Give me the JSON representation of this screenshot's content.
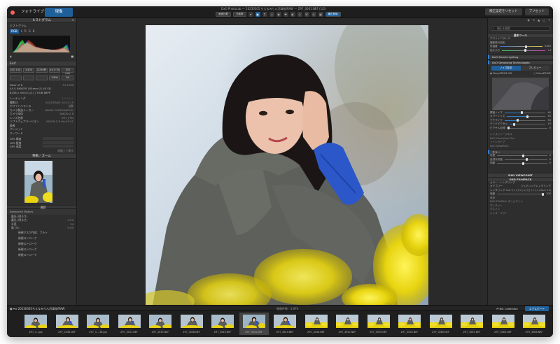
{
  "titlebar": {
    "tab_library": "フォトライブラリ",
    "tab_develop": "現像",
    "document_title": "DxO PhotoLab — 20230305 ちえ＆みりん河津桜/RAW — Z97_0001.NEF (1/2)",
    "toolbar_left_btn": "画面比較",
    "toolbar_mid_btn": "元画像",
    "toolbar_right_btn": "補正前後",
    "reset_button": "補正設定をリセット",
    "preset_button": "プリセット"
  },
  "left_panel": {
    "histogram_title": "ヒストグラム",
    "histogram_subtitle": "ヒストグラム",
    "histogram_colors": {
      "red": "#e23a3a",
      "green": "#3ad94a",
      "blue": "#2f6ef0"
    },
    "exif_title": "Exif",
    "exif_chips": [
      "ISO 100",
      "1/400",
      "1/250秒",
      "±0.0 EV",
      "105 mm"
    ],
    "exif_chips2": [
      "",
      "",
      "",
      "",
      "5/NW",
      "DX"
    ],
    "lens_name": "Nikon Z 8",
    "lens_size": "51.6 MB",
    "lens_line": "AF-S NIKKOR 105mm f/1.4E ED",
    "file_line": "8256 x 5504 (1/1) 7 RGB 8BPP",
    "meta_rows": [
      {
        "label": "レーティング",
        "value": "☆☆☆☆☆"
      },
      {
        "label": "撮影日",
        "value": "2023/03/05 10:21:15"
      },
      {
        "label": "ホワイトバランス",
        "value": "自動"
      },
      {
        "label": "カメラ製造メーカー",
        "value": "NIKON CORPORATION"
      },
      {
        "label": "カメラ本体",
        "value": "NIKON Z 8"
      },
      {
        "label": "レンズ名前",
        "value": "Z97_FTM"
      },
      {
        "label": "ソフトウェアバージョン",
        "value": "NIKON Z 8 Ver.02.01"
      },
      {
        "label": "著者",
        "value": ""
      },
      {
        "label": "クレジット",
        "value": ""
      },
      {
        "label": "キーワード",
        "value": ""
      }
    ],
    "gps_rows": [
      "GPS 緯度",
      "GPS 経度",
      "GPS 高度"
    ],
    "gps_link": "地図上で表示",
    "navigator_title": "移動／ズーム",
    "history_title": "履歴",
    "advanced_history": "Advanced History",
    "history_items": [
      {
        "label": "",
        "value": ""
      },
      {
        "label": "",
        "value": ""
      },
      {
        "label": "",
        "value": ""
      },
      {
        "label": "",
        "value": ""
      },
      {
        "label": "",
        "value": ""
      }
    ],
    "history_entries": [
      "新規マスク作成：ブラシ",
      "新規ストローク",
      "新規ストローク",
      "新規ストローク",
      "新規ストローク"
    ],
    "history_params": [
      {
        "label": "",
        "value": ""
      },
      {
        "label": "",
        "value": "0.00"
      },
      {
        "label": "",
        "value": "34"
      },
      {
        "label": "",
        "value": "0.00"
      }
    ]
  },
  "right_panel": {
    "search_placeholder": "補正を検索",
    "basic_tools": "基本ツール",
    "white_balance": "ホワイトバランス",
    "wb_mode": "撮影時の設定",
    "pickers": [
      "色温度",
      "色かぶり"
    ],
    "values": [
      "5360",
      "+4"
    ],
    "smart_lighting": "DxO Smart Lighting",
    "denoising": "DxO Denoising Technologies",
    "deepprime_xd": "DeepPRIME XD",
    "deepprime": "DeepPRIME",
    "seg_left": "ノイズ除去",
    "seg_right": "プレビュー",
    "sliders": [
      {
        "label": "輝度ノイズ",
        "value": "40"
      },
      {
        "label": "カラーノイズ",
        "value": "50"
      },
      {
        "label": "デモザイク",
        "value": "30"
      },
      {
        "label": "デッドピクセル",
        "value": "10"
      },
      {
        "label": "ピクセル処理",
        "value": "0"
      }
    ],
    "more_sections": [
      "レンズシャープネス",
      "DxO ClearView Plus",
      "トーンカーブ",
      "DxO ViewPoint"
    ],
    "color_section": "カラー",
    "color_rows": [
      {
        "label": "彩度",
        "value": "0"
      },
      {
        "label": "自然な彩度",
        "value": "0"
      },
      {
        "label": "明度",
        "value": "0"
      }
    ],
    "viewpoint_title": "DXO VIEWPOINT",
    "filmpack_title": "DXO FILMPACK",
    "color_rendering": "カラー・レンダリング",
    "rendering_category": "カテゴリー",
    "rendering_value": "ジェネリックレンダリング",
    "rendering_type": "レンダリング",
    "rendering_type_value": "DxO ワイドガマットプロファイル (Nikon Z 8)",
    "intensity_label": "強度",
    "intensity_value": "100",
    "bottom_items": [
      "暗部",
      "DxO FilmPack タイムマシン",
      "ヴィネット",
      "グレイン",
      "レンズ・ブラー"
    ]
  },
  "filmbar": {
    "folder": "20230305ちえ＆みりん河津桜/RAW",
    "count": "画像件数 : 1,974",
    "nik_collection": "Nik Collection",
    "export": "エクスポート"
  },
  "film_frames": [
    {
      "name": "Z97_3...jpg",
      "variant": "pose_a"
    },
    {
      "name": "Z97_2046.NEF",
      "variant": "pose_b"
    },
    {
      "name": "Z97_3....36.jpg",
      "variant": "pose_a"
    },
    {
      "name": "Z97_3031.NEF",
      "variant": "pose_b"
    },
    {
      "name": "Z97_3035.NEF",
      "variant": "pose_a"
    },
    {
      "name": "Z97_3038.NEF",
      "variant": "pose_b"
    },
    {
      "name": "Z97_3040.NEF",
      "variant": "pose_a"
    },
    {
      "name": "Z97_3041.NEF",
      "variant": "pose_c"
    },
    {
      "name": "Z97_3043.NEF",
      "variant": "pose_b"
    },
    {
      "name": "Z97_3048.NEF",
      "variant": "wide"
    },
    {
      "name": "Z97_3052.NEF",
      "variant": "wide"
    },
    {
      "name": "Z97_3055.NEF",
      "variant": "wide"
    },
    {
      "name": "Z97_3058.NEF",
      "variant": "wide"
    },
    {
      "name": "Z97_3060.NEF",
      "variant": "wide"
    },
    {
      "name": "Z97_3062.NEF",
      "variant": "wide"
    },
    {
      "name": "Z97_3065.NEF",
      "variant": "wide"
    },
    {
      "name": "Z97_3068.NEF",
      "variant": "wide"
    }
  ],
  "selected_frame": 7,
  "colors": {
    "accent": "#1f5f9a",
    "panel": "#2e2e2e",
    "viewer": "#2a2a2a"
  }
}
